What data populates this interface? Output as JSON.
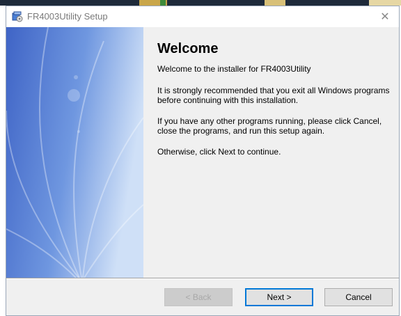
{
  "window": {
    "title": "FR4003Utility Setup",
    "close_glyph": "✕",
    "icon": "setup-icon"
  },
  "content": {
    "heading": "Welcome",
    "intro": "Welcome to the installer for FR4003Utility",
    "recommendation": "It is strongly recommended that you exit all Windows programs before continuing with this installation.",
    "other_programs": "If you have any other programs running, please click Cancel, close the programs, and run this setup again.",
    "continue_hint": "Otherwise, click Next to continue."
  },
  "buttons": {
    "back_label": "< Back",
    "next_label": "Next >",
    "cancel_label": "Cancel",
    "back_enabled": false
  },
  "colors": {
    "banner_dark": "#3f64c6",
    "banner_light": "#cfe0f7",
    "accent": "#0078d7"
  }
}
